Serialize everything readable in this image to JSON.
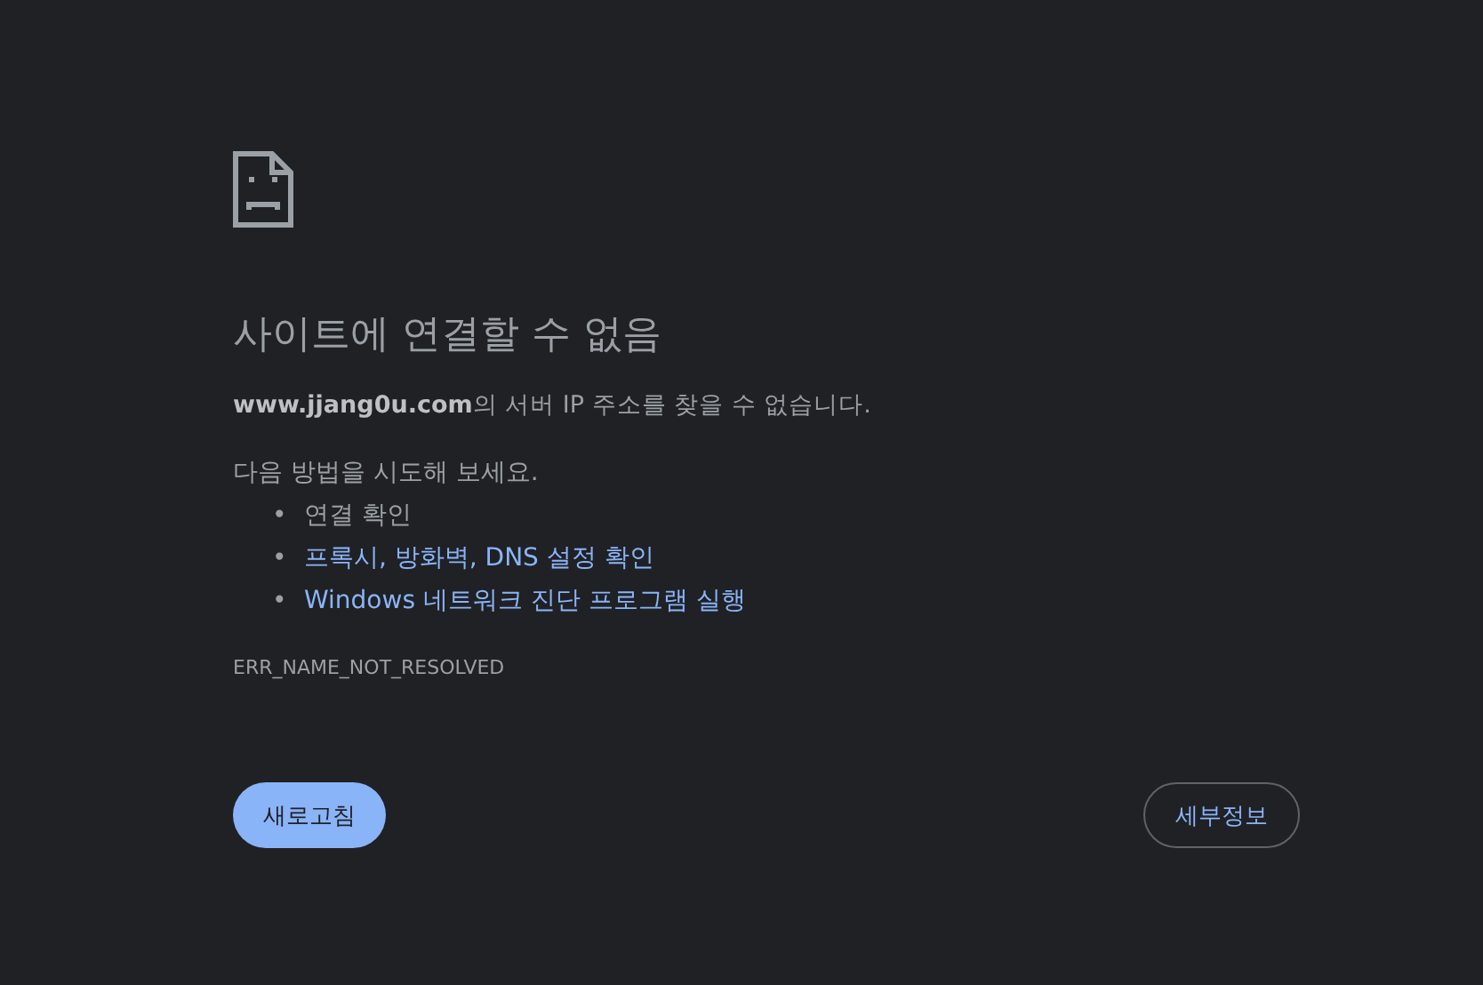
{
  "title": "사이트에 연결할 수 없음",
  "description": {
    "host": "www.jjang0u.com",
    "rest": "의 서버 IP 주소를 찾을 수 없습니다."
  },
  "suggestions_heading": "다음 방법을 시도해 보세요.",
  "suggestions": [
    {
      "kind": "text",
      "bullet": "•",
      "label": "연결 확인"
    },
    {
      "kind": "link",
      "bullet": "•",
      "label": "프록시, 방화벽, DNS 설정 확인"
    },
    {
      "kind": "link",
      "bullet": "•",
      "label": "Windows 네트워크 진단 프로그램 실행"
    }
  ],
  "error_code": "ERR_NAME_NOT_RESOLVED",
  "buttons": [
    {
      "kind": "primary",
      "label": "새로고침"
    },
    {
      "kind": "secondary",
      "label": "세부정보"
    }
  ]
}
